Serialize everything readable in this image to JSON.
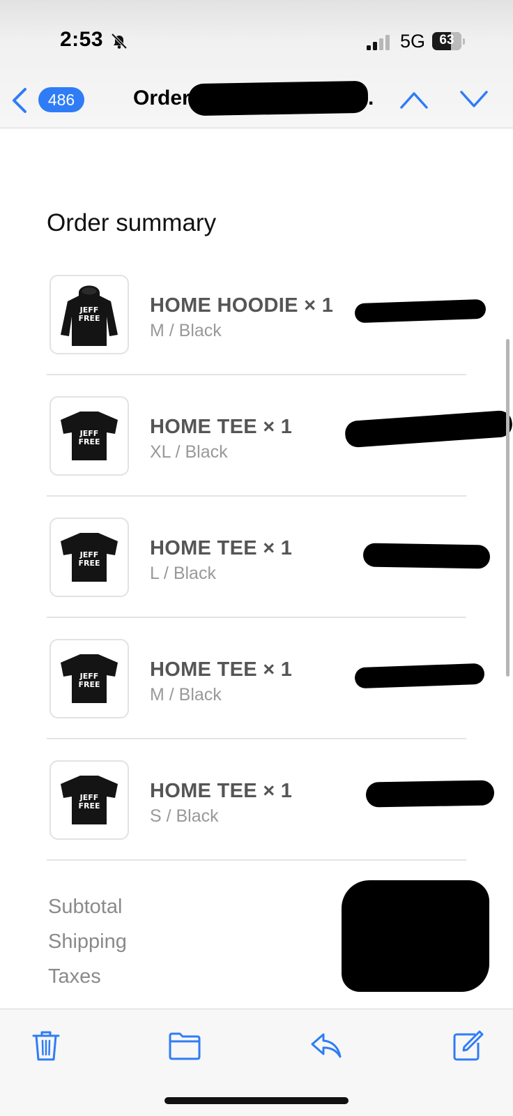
{
  "status_bar": {
    "time": "2:53",
    "network": "5G",
    "battery": "63"
  },
  "nav": {
    "unread_count": "486",
    "subject": "Order #•••••••••••••••••co...",
    "accent_color": "#2f7cf6"
  },
  "order": {
    "section_title": "Order summary",
    "items": [
      {
        "name": "HOME HOODIE × 1",
        "variant": "M / Black",
        "product": "hoodie",
        "print_text": "JEFF FREE"
      },
      {
        "name": "HOME TEE × 1",
        "variant": "XL / Black",
        "product": "tee",
        "print_text": "JEFF FREE"
      },
      {
        "name": "HOME TEE × 1",
        "variant": "L / Black",
        "product": "tee",
        "print_text": "JEFF FREE"
      },
      {
        "name": "HOME TEE × 1",
        "variant": "M / Black",
        "product": "tee",
        "print_text": "JEFF FREE"
      },
      {
        "name": "HOME TEE × 1",
        "variant": "S / Black",
        "product": "tee",
        "print_text": "JEFF FREE"
      }
    ],
    "summary_labels": {
      "subtotal": "Subtotal",
      "shipping": "Shipping",
      "taxes": "Taxes"
    }
  },
  "toolbar": {
    "icons": [
      "trash-icon",
      "folder-icon",
      "reply-icon",
      "compose-icon"
    ]
  }
}
